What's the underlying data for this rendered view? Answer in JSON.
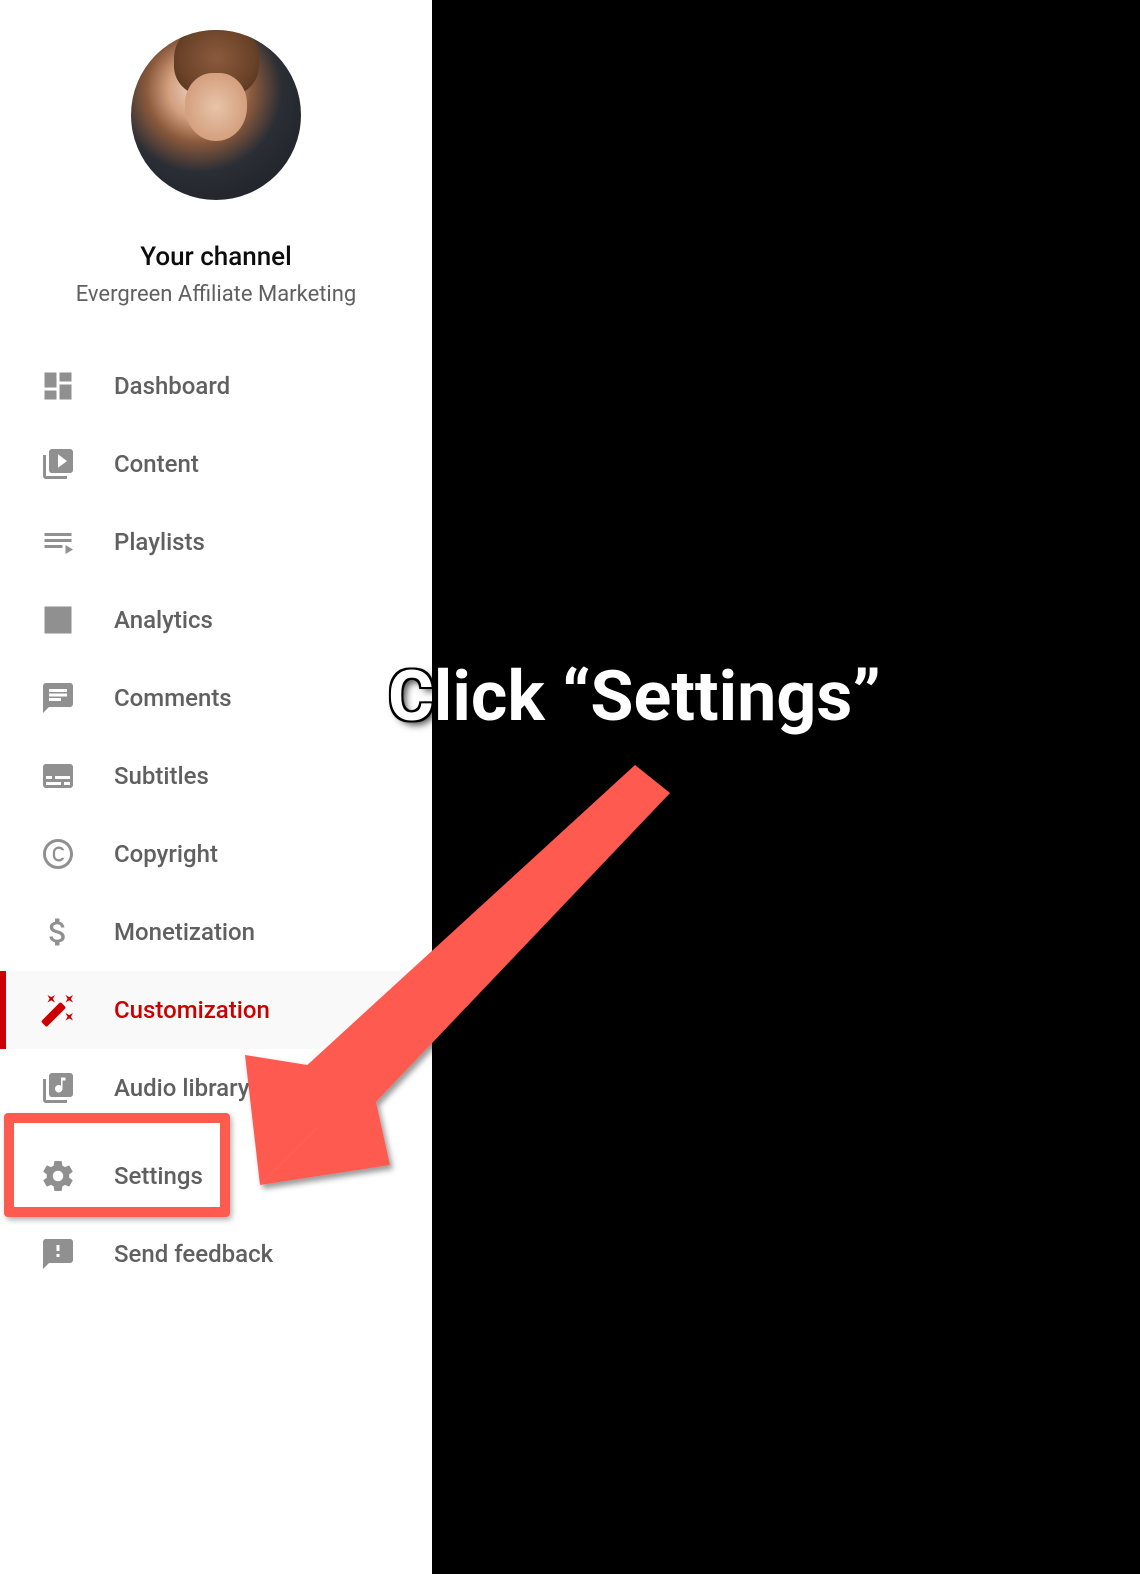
{
  "channel": {
    "title": "Your channel",
    "name": "Evergreen Affiliate Marketing"
  },
  "nav": {
    "items": [
      {
        "label": "Dashboard",
        "icon": "dashboard-icon",
        "active": false
      },
      {
        "label": "Content",
        "icon": "content-icon",
        "active": false
      },
      {
        "label": "Playlists",
        "icon": "playlists-icon",
        "active": false
      },
      {
        "label": "Analytics",
        "icon": "analytics-icon",
        "active": false
      },
      {
        "label": "Comments",
        "icon": "comments-icon",
        "active": false
      },
      {
        "label": "Subtitles",
        "icon": "subtitles-icon",
        "active": false
      },
      {
        "label": "Copyright",
        "icon": "copyright-icon",
        "active": false
      },
      {
        "label": "Monetization",
        "icon": "monetization-icon",
        "active": false
      },
      {
        "label": "Customization",
        "icon": "customization-icon",
        "active": true
      },
      {
        "label": "Audio library",
        "icon": "audio-library-icon",
        "active": false
      }
    ],
    "bottom": [
      {
        "label": "Settings",
        "icon": "settings-icon"
      },
      {
        "label": "Send feedback",
        "icon": "feedback-icon"
      }
    ]
  },
  "annotation": {
    "text": "Click “Settings”",
    "highlight_color": "#ff5a4f"
  }
}
